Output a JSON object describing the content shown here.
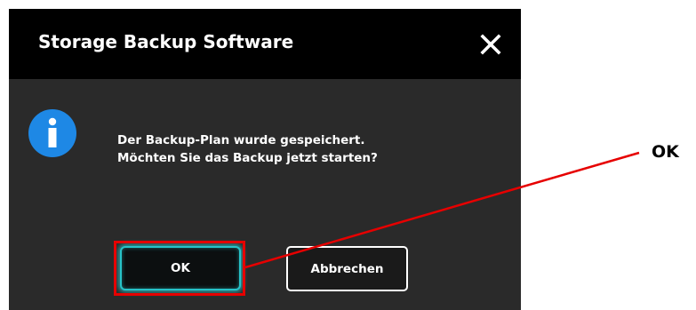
{
  "dialog": {
    "title": "Storage Backup Software",
    "close_icon": "close-icon",
    "info_icon": "info-icon",
    "message_line1": "Der Backup-Plan wurde gespeichert.",
    "message_line2": "Möchten Sie das Backup jetzt starten?",
    "ok_label": "OK",
    "cancel_label": "Abbrechen"
  },
  "annotation": {
    "label": "OK",
    "color": "#e60000"
  },
  "colors": {
    "titlebar": "#000000",
    "body": "#2a2a2a",
    "info_icon": "#1e88e5",
    "ok_glow": "#27c2c8"
  }
}
